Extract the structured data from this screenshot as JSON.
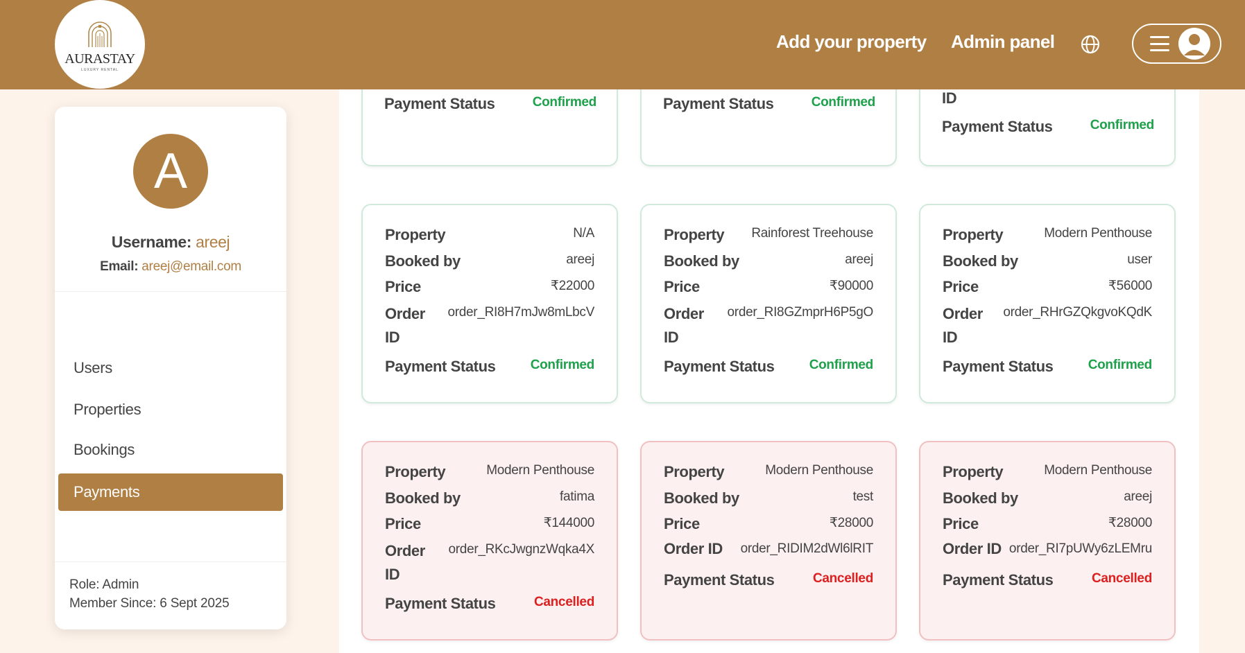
{
  "header": {
    "logo_text": "AURASTAY",
    "logo_sub": "LUXURY RENTAL",
    "add_property": "Add your property",
    "admin_panel": "Admin panel",
    "globe_icon": "globe-icon",
    "menu_icon": "hamburger-icon",
    "account_icon": "user-circle-icon"
  },
  "sidebar": {
    "avatar_letter": "A",
    "username_label": "Username:",
    "username": "areej",
    "email_label": "Email:",
    "email": "areej@email.com",
    "items": [
      {
        "label": "Users"
      },
      {
        "label": "Properties"
      },
      {
        "label": "Bookings"
      },
      {
        "label": "Payments"
      }
    ],
    "role": "Role: Admin",
    "member_since": "Member Since: 6 Sept 2025"
  },
  "labels": {
    "property": "Property",
    "booked_by": "Booked by",
    "price": "Price",
    "order": "Order",
    "id": "ID",
    "order_id": "Order ID",
    "payment_status": "Payment Status"
  },
  "payments_partial": [
    {
      "status": "Confirmed"
    },
    {
      "status": "Confirmed"
    },
    {
      "status": "Confirmed"
    }
  ],
  "payments": [
    {
      "property": "N/A",
      "booked_by": "areej",
      "price": "₹22000",
      "order_id": "order_RI8H7mJw8mLbcV",
      "status": "Confirmed"
    },
    {
      "property": "Rainforest Treehouse",
      "booked_by": "areej",
      "price": "₹90000",
      "order_id": "order_RI8GZmprH6P5gO",
      "status": "Confirmed"
    },
    {
      "property": "Modern Penthouse",
      "booked_by": "user",
      "price": "₹56000",
      "order_id": "order_RHrGZQkgvoKQdK",
      "status": "Confirmed"
    },
    {
      "property": "Modern Penthouse",
      "booked_by": "fatima",
      "price": "₹144000",
      "order_id": "order_RKcJwgnzWqka4X",
      "status": "Cancelled"
    },
    {
      "property": "Modern Penthouse",
      "booked_by": "test",
      "price": "₹28000",
      "order_id": "order_RIDIM2dWl6lRIT",
      "status": "Cancelled"
    },
    {
      "property": "Modern Penthouse",
      "booked_by": "areej",
      "price": "₹28000",
      "order_id": "order_RI7pUWy6zLEMru",
      "status": "Cancelled"
    }
  ],
  "colors": {
    "brand": "#b07f44",
    "confirmed": "#1fa04b",
    "cancelled": "#dc1f1f"
  }
}
